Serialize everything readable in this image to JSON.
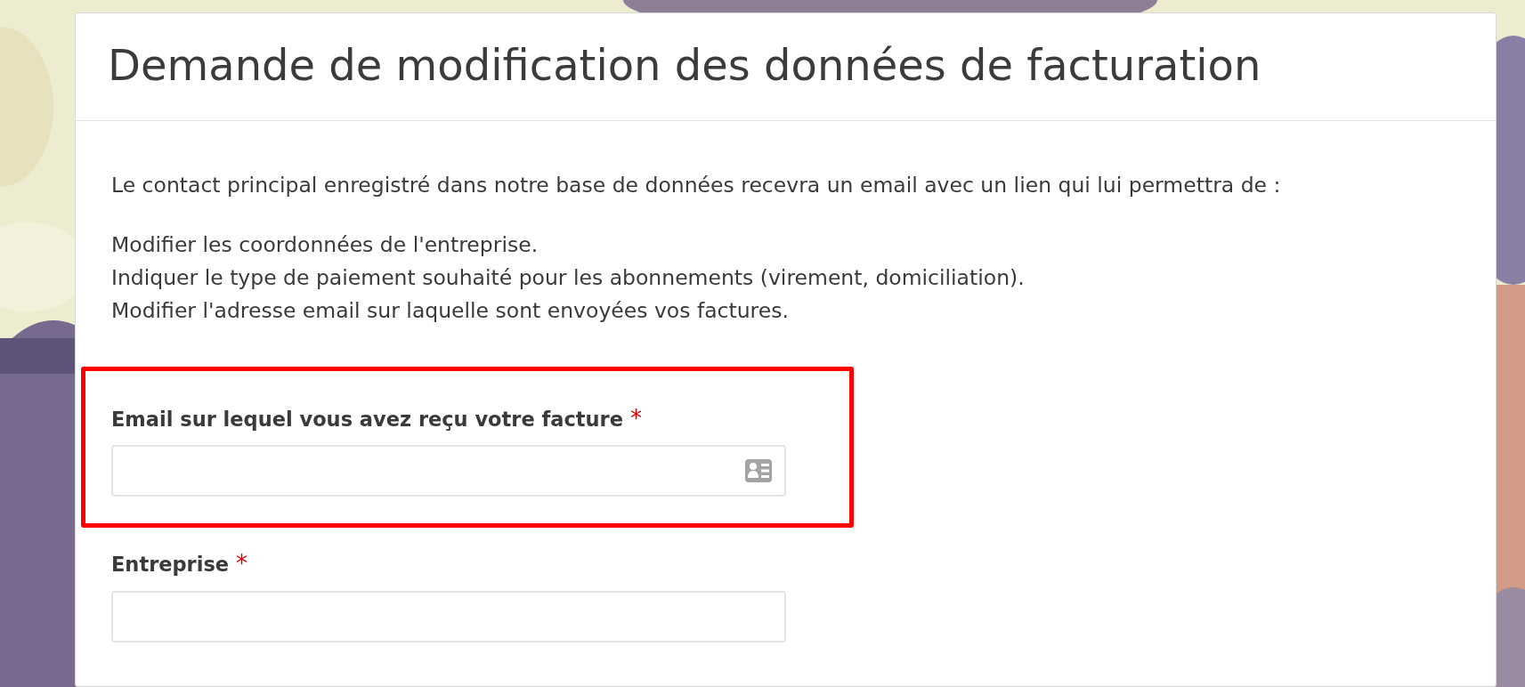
{
  "title": "Demande de modification des données de facturation",
  "intro": "Le contact principal enregistré dans notre base de données recevra un email avec un lien qui lui permettra de :",
  "items": [
    "Modifier les coordonnées de l'entreprise.",
    "Indiquer le type de paiement souhaité pour les abonnements (virement, domiciliation).",
    "Modifier l'adresse email sur laquelle sont envoyées vos factures."
  ],
  "fields": [
    {
      "kind": "email",
      "label": "Email sur lequel vous avez reçu votre facture",
      "required": true,
      "required_mark": "*",
      "highlighted": true
    },
    {
      "kind": "text",
      "label": "Entreprise",
      "required": true,
      "required_mark": "*",
      "highlighted": false
    }
  ]
}
